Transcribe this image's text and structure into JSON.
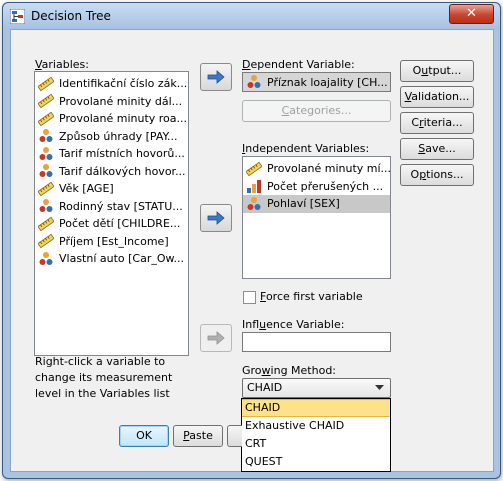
{
  "window": {
    "title": "Decision Tree",
    "close_label": "✕"
  },
  "variables_panel": {
    "label_pre": "",
    "label_underlined": "V",
    "label_post": "ariables:",
    "items": [
      {
        "label": "Identifikační číslo zák...",
        "icon": "scale-ruler-icon"
      },
      {
        "label": "Provolané minity dál...",
        "icon": "scale-ruler-icon"
      },
      {
        "label": "Provolané minuty roa...",
        "icon": "scale-ruler-icon"
      },
      {
        "label": "Způsob úhrady [PAY...",
        "icon": "nominal-icon"
      },
      {
        "label": "Tarif místních hovorů...",
        "icon": "nominal-icon"
      },
      {
        "label": "Tarif dálkových hovor...",
        "icon": "nominal-icon"
      },
      {
        "label": "Věk [AGE]",
        "icon": "scale-ruler-icon"
      },
      {
        "label": "Rodinný stav [STATU...",
        "icon": "nominal-icon"
      },
      {
        "label": "Počet dětí [CHILDRE...",
        "icon": "scale-ruler-icon"
      },
      {
        "label": "Příjem [Est_Income]",
        "icon": "scale-ruler-icon"
      },
      {
        "label": "Vlastní auto [Car_Ow...",
        "icon": "nominal-icon"
      }
    ],
    "hint_lines": [
      "Right-click a variable to",
      "change its measurement",
      "level in the Variables list"
    ]
  },
  "dependent": {
    "label_pre": "",
    "label_underlined": "D",
    "label_post": "ependent Variable:",
    "value": "Příznak loajality [CH...",
    "categories_pre": "",
    "categories_underlined": "C",
    "categories_post": "ategories..."
  },
  "independent": {
    "label_pre": "",
    "label_underlined": "I",
    "label_post": "ndependent Variables:",
    "items": [
      {
        "label": "Provolané minuty mí...",
        "icon": "scale-ruler-icon",
        "selected": false
      },
      {
        "label": "Počet přerušených ...",
        "icon": "ordinal-icon",
        "selected": false
      },
      {
        "label": "Pohlaví [SEX]",
        "icon": "nominal-icon",
        "selected": true
      }
    ]
  },
  "force_first": {
    "label_pre": "",
    "label_underlined": "F",
    "label_post": "orce first variable",
    "checked": false
  },
  "influence": {
    "label_pre": "Infl",
    "label_underlined": "u",
    "label_post": "ence Variable:",
    "value": ""
  },
  "growing_method": {
    "label_pre": "Gro",
    "label_underlined": "w",
    "label_post": "ing Method:",
    "selected": "CHAID",
    "options": [
      "CHAID",
      "Exhaustive CHAID",
      "CRT",
      "QUEST"
    ],
    "highlighted_index": 0
  },
  "side_buttons": [
    {
      "pre": "O",
      "u": "u",
      "post": "tput..."
    },
    {
      "pre": "",
      "u": "V",
      "post": "alidation..."
    },
    {
      "pre": "C",
      "u": "r",
      "post": "iteria..."
    },
    {
      "pre": "",
      "u": "S",
      "post": "ave..."
    },
    {
      "pre": "O",
      "u": "p",
      "post": "tions..."
    }
  ],
  "bottom_buttons": {
    "ok": "OK",
    "paste_pre": "",
    "paste_u": "P",
    "paste_post": "aste"
  },
  "colors": {
    "titlebar": "#a9c3e0",
    "close": "#c8452f",
    "arrow": "#3a79c8",
    "highlight": "#fde28a"
  }
}
